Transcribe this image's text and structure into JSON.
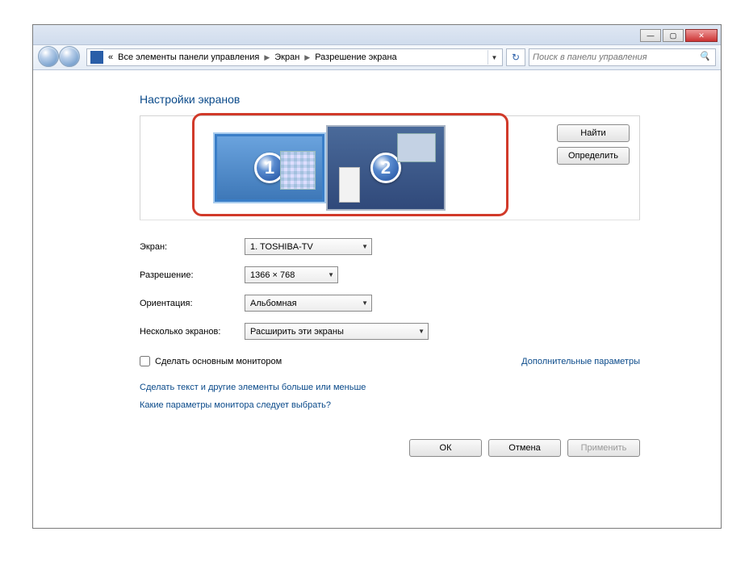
{
  "window": {
    "breadcrumb": {
      "prefix": "«",
      "items": [
        "Все элементы панели управления",
        "Экран",
        "Разрешение экрана"
      ]
    },
    "search_placeholder": "Поиск в панели управления"
  },
  "heading": "Настройки экранов",
  "monitors": [
    {
      "number": "1",
      "selected": true
    },
    {
      "number": "2",
      "selected": false
    }
  ],
  "side_buttons": {
    "find": "Найти",
    "identify": "Определить"
  },
  "form": {
    "display_label": "Экран:",
    "display_value": "1. TOSHIBA-TV",
    "resolution_label": "Разрешение:",
    "resolution_value": "1366 × 768",
    "orientation_label": "Ориентация:",
    "orientation_value": "Альбомная",
    "multi_label": "Несколько экранов:",
    "multi_value": "Расширить эти экраны"
  },
  "checkbox": {
    "label": "Сделать основным монитором",
    "checked": false
  },
  "advanced_link": "Дополнительные параметры",
  "links": [
    "Сделать текст и другие элементы больше или меньше",
    "Какие параметры монитора следует выбрать?"
  ],
  "footer": {
    "ok": "ОК",
    "cancel": "Отмена",
    "apply": "Применить"
  }
}
